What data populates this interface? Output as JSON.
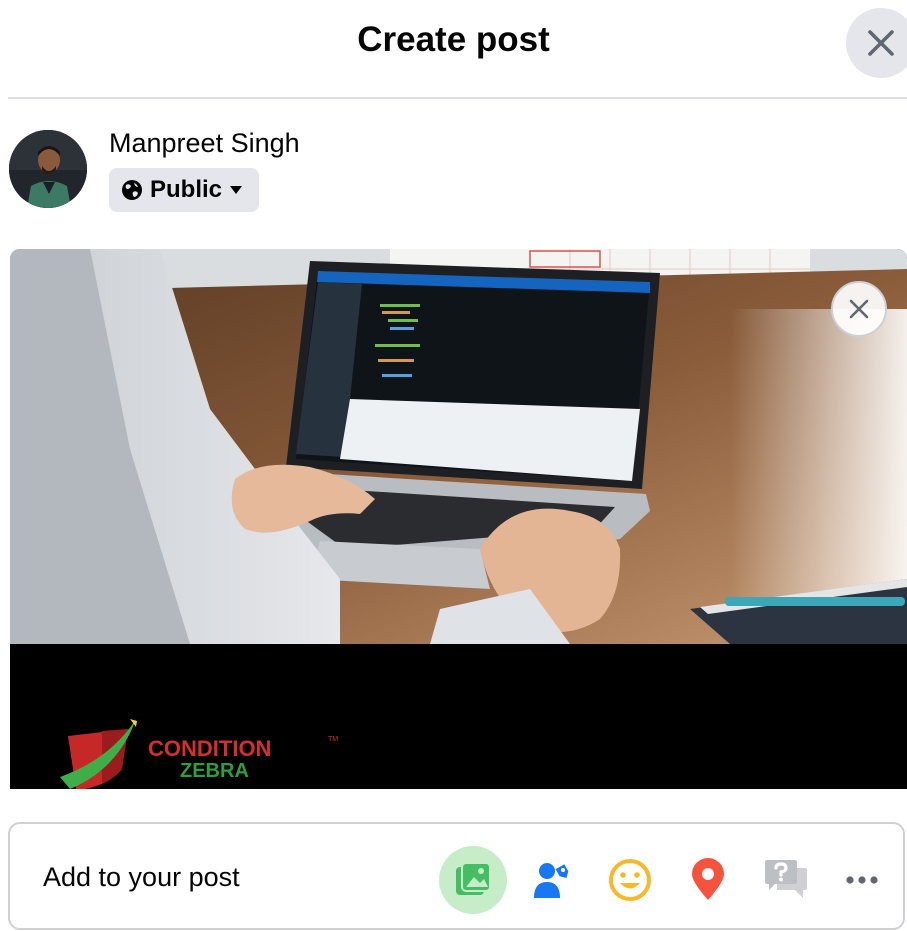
{
  "dialog": {
    "title": "Create post",
    "close_label": "Close"
  },
  "author": {
    "name": "Manpreet Singh",
    "privacy": "Public"
  },
  "media": {
    "brand_line1": "CONDITION",
    "brand_line2": "ZEBRA",
    "brand_tm": "TM"
  },
  "add_to_post": {
    "label": "Add to your post",
    "tools": [
      {
        "icon": "photo-video-icon",
        "color": "#45bd62"
      },
      {
        "icon": "tag-people-icon",
        "color": "#1877f2"
      },
      {
        "icon": "feeling-icon",
        "color": "#f7b928"
      },
      {
        "icon": "check-in-icon",
        "color": "#f5533d"
      },
      {
        "icon": "ask-question-icon",
        "color": "#bcc0c4"
      },
      {
        "icon": "more-icon",
        "color": "#606770"
      }
    ]
  }
}
